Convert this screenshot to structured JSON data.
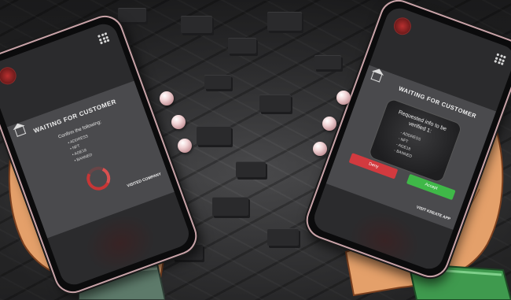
{
  "left_phone": {
    "logo_icon": "red-spider-emblem-icon",
    "menu_icon": "grid-menu-icon",
    "home_icon": "home-icon",
    "title": "WAITING FOR CUSTOMER",
    "confirm_text": "Confirm the following:",
    "items": [
      "ADDRESS",
      "NFT",
      "AGE18",
      "BANNED"
    ],
    "status": "loading-spinner",
    "visit_link": "VISITED COMPANY"
  },
  "right_phone": {
    "logo_icon": "red-spider-emblem-icon",
    "menu_icon": "grid-menu-icon",
    "home_icon": "home-icon",
    "title": "WAITING FOR CUSTOMER",
    "request_heading_line1": "Requested info to be",
    "request_heading_line2": "verified 1:",
    "items": [
      "ADDRESS",
      "NFT",
      "AGE18",
      "BANNED"
    ],
    "deny_label": "Deny",
    "accept_label": "Accept",
    "visit_link": "VISIT KREATE APP"
  },
  "colors": {
    "deny": "#d23a3f",
    "accept": "#3fb848",
    "spinner": "#c73636"
  }
}
